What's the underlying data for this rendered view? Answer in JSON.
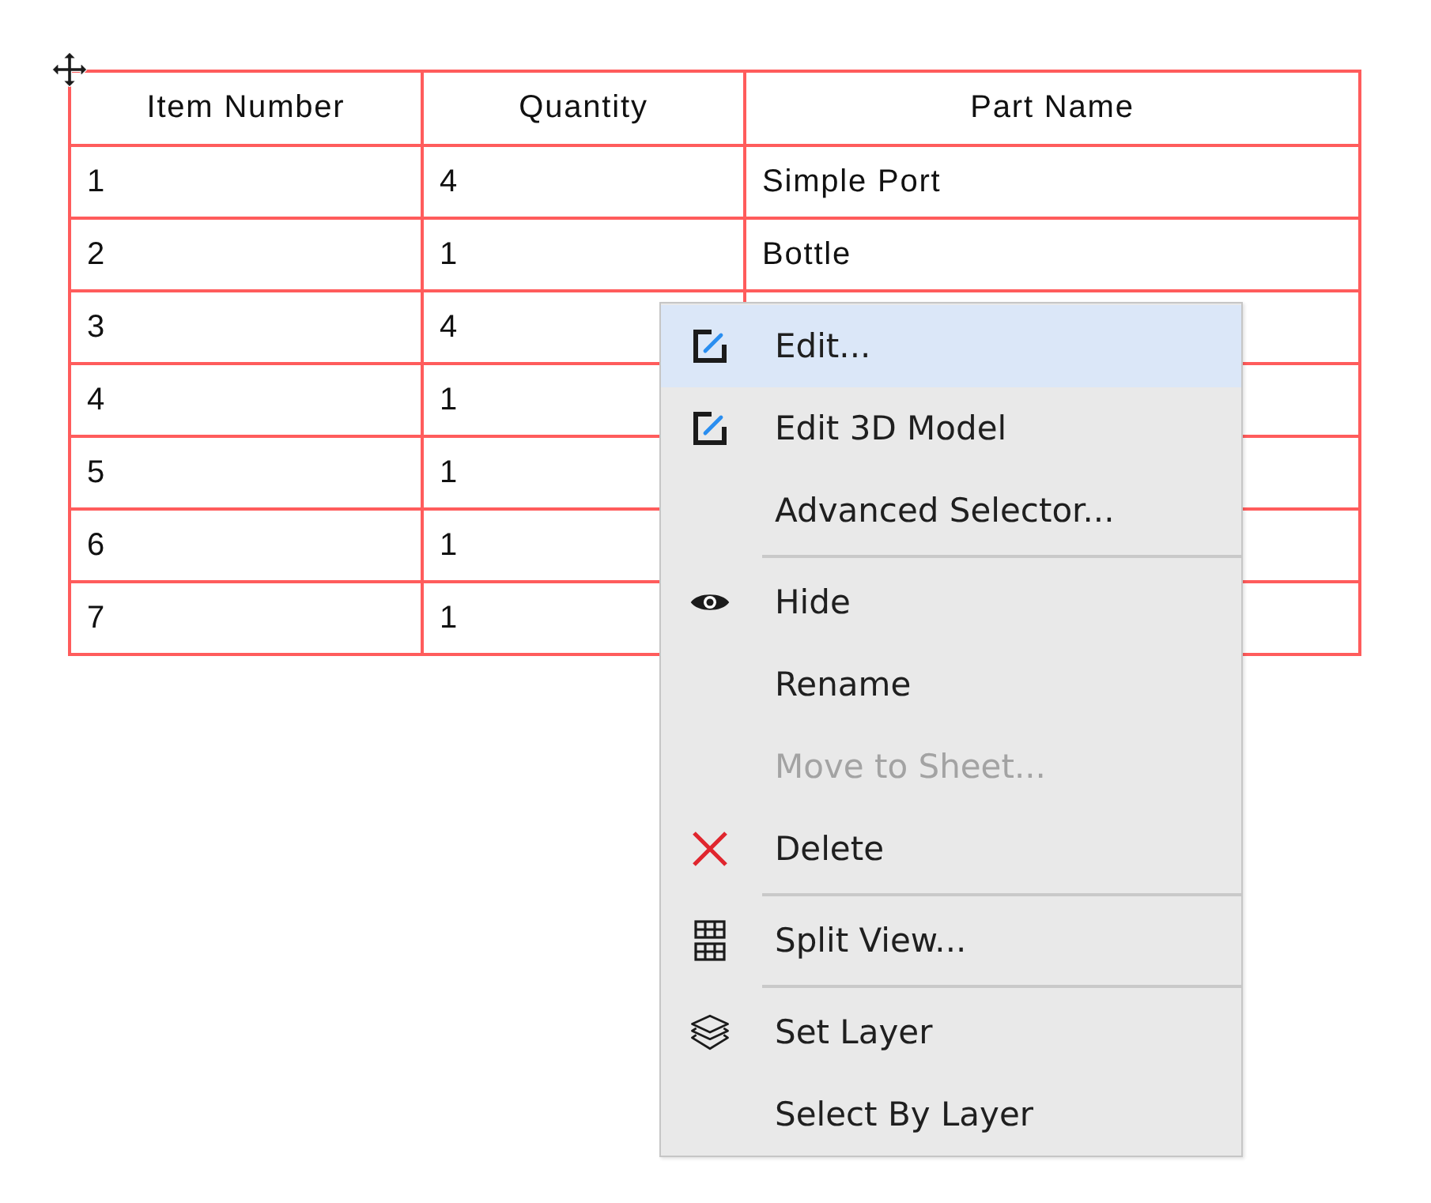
{
  "table": {
    "columns": [
      "Item Number",
      "Quantity",
      "Part Name"
    ],
    "rows": [
      {
        "item_number": "1",
        "quantity": "4",
        "part_name": "Simple Port"
      },
      {
        "item_number": "2",
        "quantity": "1",
        "part_name": "Bottle"
      },
      {
        "item_number": "3",
        "quantity": "4"
      },
      {
        "item_number": "4",
        "quantity": "1"
      },
      {
        "item_number": "5",
        "quantity": "1"
      },
      {
        "item_number": "6",
        "quantity": "1"
      },
      {
        "item_number": "7",
        "quantity": "1"
      }
    ]
  },
  "context_menu": {
    "groups": [
      {
        "items": [
          {
            "label": "Edit...",
            "selected": true,
            "disabled": false
          },
          {
            "label": "Edit 3D Model",
            "selected": false,
            "disabled": false
          },
          {
            "label": "Advanced Selector...",
            "selected": false,
            "disabled": false
          }
        ]
      },
      {
        "items": [
          {
            "label": "Hide",
            "selected": false,
            "disabled": false
          },
          {
            "label": "Rename",
            "selected": false,
            "disabled": false
          },
          {
            "label": "Move to Sheet...",
            "selected": false,
            "disabled": true
          },
          {
            "label": "Delete",
            "selected": false,
            "disabled": false
          }
        ]
      },
      {
        "items": [
          {
            "label": "Split View...",
            "selected": false,
            "disabled": false
          }
        ]
      },
      {
        "items": [
          {
            "label": "Set Layer",
            "selected": false,
            "disabled": false
          },
          {
            "label": "Select By Layer",
            "selected": false,
            "disabled": false
          }
        ]
      }
    ]
  }
}
